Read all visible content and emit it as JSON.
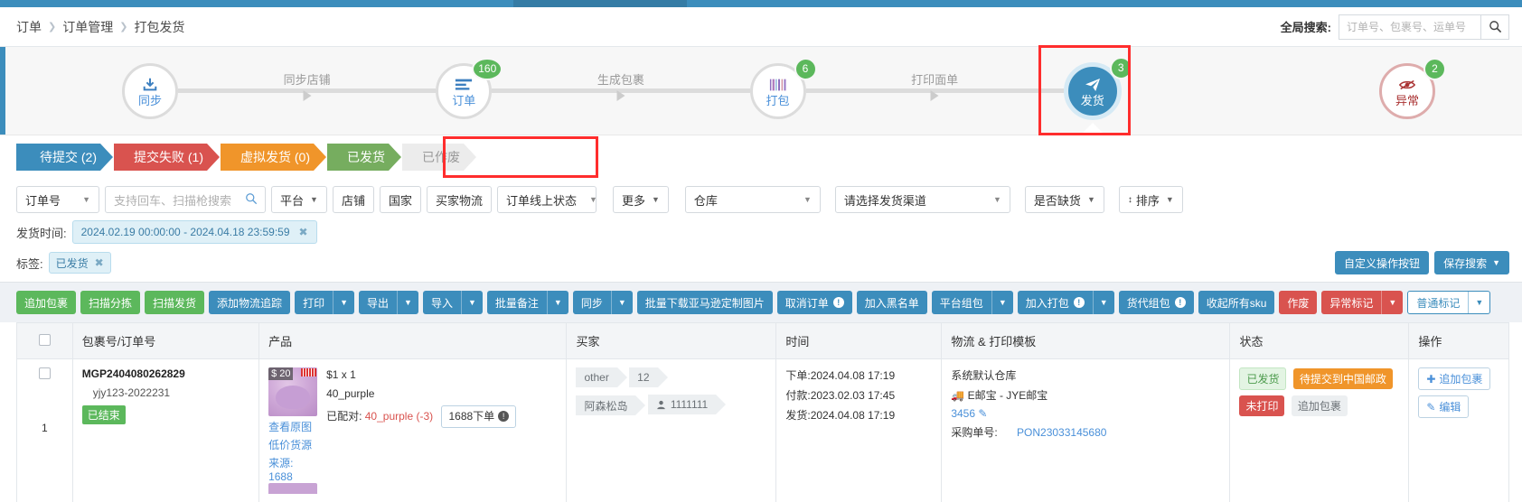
{
  "breadcrumb": {
    "items": [
      "订单",
      "订单管理",
      "打包发货"
    ]
  },
  "global_search": {
    "label": "全局搜索:",
    "placeholder": "订单号、包裹号、运单号",
    "value": "",
    "icon": "search-icon"
  },
  "stepper": {
    "steps": [
      {
        "label": "同步",
        "badge": "",
        "icon": "download-icon",
        "state": "normal"
      },
      {
        "label": "订单",
        "badge": "160",
        "icon": "list-icon",
        "state": "normal"
      },
      {
        "label": "打包",
        "badge": "6",
        "icon": "barcode-icon",
        "state": "normal"
      },
      {
        "label": "发货",
        "badge": "3",
        "icon": "send-icon",
        "state": "active"
      },
      {
        "label": "异常",
        "badge": "2",
        "icon": "alert-eye-icon",
        "state": "error"
      }
    ],
    "connectors": [
      "同步店铺",
      "生成包裹",
      "打印面单",
      ""
    ]
  },
  "tabs": [
    {
      "label": "待提交 (2)",
      "color": "c-blue",
      "selected": false
    },
    {
      "label": "提交失败 (1)",
      "color": "c-red",
      "selected": false
    },
    {
      "label": "虚拟发货 (0)",
      "color": "c-orange",
      "selected": false
    },
    {
      "label": "已发货",
      "color": "c-green",
      "selected": true
    },
    {
      "label": "已作废",
      "color": "c-gray",
      "selected": false
    }
  ],
  "filters": {
    "order_no_select": "订单号",
    "search_placeholder": "支持回车、扫描枪搜索",
    "platform": "平台",
    "shop": "店铺",
    "country": "国家",
    "buyer_logistics": "买家物流",
    "order_online_status": "订单线上状态",
    "more": "更多",
    "warehouse": "仓库",
    "ship_channel": "请选择发货渠道",
    "out_of_stock": "是否缺货",
    "sort": "排序",
    "ship_time_label": "发货时间:",
    "ship_time_value": "2024.02.19 00:00:00 - 2024.04.18 23:59:59",
    "tag_label": "标签:",
    "tag_value": "已发货",
    "custom_buttons": "自定义操作按钮",
    "save_search": "保存搜索"
  },
  "toolbar": [
    {
      "label": "追加包裹",
      "color": "green"
    },
    {
      "label": "扫描分拣",
      "color": "green"
    },
    {
      "label": "扫描发货",
      "color": "green"
    },
    {
      "label": "添加物流追踪",
      "color": "blue"
    },
    {
      "label": "打印",
      "color": "blue",
      "caret": true
    },
    {
      "label": "导出",
      "color": "blue",
      "caret": true
    },
    {
      "label": "导入",
      "color": "blue",
      "caret": true
    },
    {
      "label": "批量备注",
      "color": "blue",
      "caret": true
    },
    {
      "label": "同步",
      "color": "blue",
      "caret": true
    },
    {
      "label": "批量下载亚马逊定制图片",
      "color": "blue"
    },
    {
      "label": "取消订单",
      "color": "blue",
      "warn": true
    },
    {
      "label": "加入黑名单",
      "color": "blue"
    },
    {
      "label": "平台组包",
      "color": "blue",
      "caret": true
    },
    {
      "label": "加入打包",
      "color": "blue",
      "warn": true,
      "caret": true
    },
    {
      "label": "货代组包",
      "color": "blue",
      "warn": true
    },
    {
      "label": "收起所有sku",
      "color": "blue"
    },
    {
      "label": "作废",
      "color": "red"
    },
    {
      "label": "异常标记",
      "color": "red",
      "caret": true
    },
    {
      "label": "普通标记",
      "color": "white",
      "caret": true
    }
  ],
  "table": {
    "columns": [
      "",
      "包裹号/订单号",
      "产品",
      "买家",
      "时间",
      "物流 & 打印模板",
      "状态",
      "操作"
    ],
    "rows": [
      {
        "index": "1",
        "package_no": "MGP2404080262829",
        "sub_order": "yjy123-2022231",
        "status_tag": "已结束",
        "product": {
          "price_overlay": "$ 20",
          "qty": "$1 x 1",
          "sku": "40_purple",
          "matched_label": "已配对:",
          "matched_value": "40_purple (-3)",
          "order_button": "1688下单",
          "view_image": "查看原图",
          "low_price_source": "低价货源",
          "source_label": "来源: 1688"
        },
        "buyer": {
          "chips": [
            "other",
            "12"
          ],
          "chips2": [
            "阿森松岛",
            "1111111"
          ]
        },
        "time": {
          "order": "下单:2024.04.08 17:19",
          "pay": "付款:2023.02.03 17:45",
          "ship": "发货:2024.04.08 17:19"
        },
        "logistics": {
          "warehouse": "系统默认仓库",
          "carrier": "E邮宝 - JYE邮宝",
          "tracking": "3456",
          "po_label": "采购单号:",
          "po_value": "PON23033145680"
        },
        "status": [
          {
            "text": "已发货",
            "cls": "st-green"
          },
          {
            "text": "待提交到中国邮政",
            "cls": "st-orange"
          },
          {
            "text": "未打印",
            "cls": "st-red"
          },
          {
            "text": "追加包裹",
            "cls": "st-gray"
          }
        ],
        "operations": [
          "追加包裹",
          "编辑"
        ]
      }
    ]
  }
}
